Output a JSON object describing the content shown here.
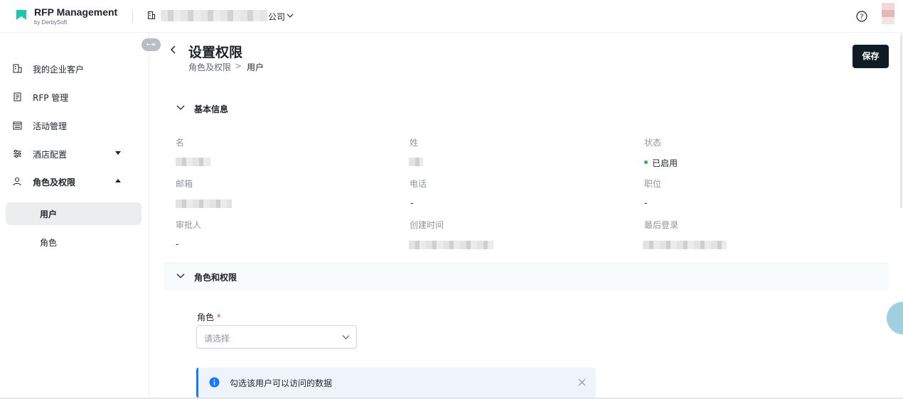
{
  "app": {
    "title": "RFP Management",
    "subtitle": "by DerbySoft",
    "company_suffix": "公司",
    "brand_color": "#18c9b0"
  },
  "sidebar": {
    "collapse_label": "←≡",
    "items": [
      {
        "label": "我的企业客户",
        "icon": "building-icon"
      },
      {
        "label": "RFP 管理",
        "icon": "document-icon"
      },
      {
        "label": "活动管理",
        "icon": "calendar-list-icon"
      },
      {
        "label": "酒店配置",
        "icon": "sliders-icon",
        "caret": "down"
      },
      {
        "label": "角色及权限",
        "icon": "user-icon",
        "caret": "up"
      }
    ],
    "sub_items": [
      {
        "label": "用户",
        "active": true
      },
      {
        "label": "角色",
        "active": false
      }
    ]
  },
  "page": {
    "title": "设置权限",
    "breadcrumb": [
      "角色及权限",
      "用户"
    ],
    "breadcrumb_separator": ">",
    "save_label": "保存"
  },
  "basic_info": {
    "section_title": "基本信息",
    "fields": {
      "first_name": {
        "label": "名"
      },
      "last_name": {
        "label": "姓"
      },
      "status": {
        "label": "状态",
        "value": "已启用",
        "color": "#2fb344"
      },
      "email": {
        "label": "邮箱"
      },
      "phone": {
        "label": "电话",
        "value": "-"
      },
      "position": {
        "label": "职位",
        "value": "-"
      },
      "approver": {
        "label": "审批人",
        "value": "-"
      },
      "created_at": {
        "label": "创建时间"
      },
      "last_login": {
        "label": "最后登录"
      }
    }
  },
  "roles": {
    "section_title": "角色和权限",
    "role_label": "角色",
    "required_mark": "*",
    "select_placeholder": "请选择",
    "info_text": "勾选该用户可以访问的数据",
    "info_color": "#1677ff"
  }
}
